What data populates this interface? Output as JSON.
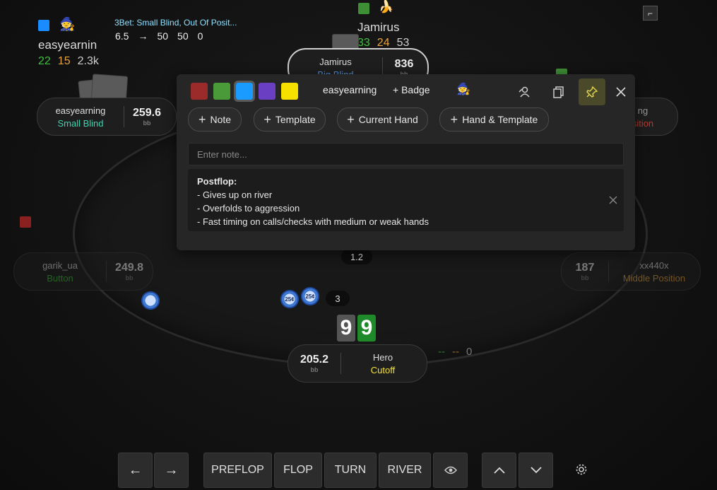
{
  "top_left_player": {
    "name": "easyearnin",
    "stats": [
      "22",
      "15",
      "2.3k"
    ],
    "stat_colors": [
      "#3ec23e",
      "#e8a33c",
      "#cfcfcf"
    ],
    "action_line": "3Bet: Small Blind, Out Of Posit...",
    "action_values": [
      "6.5",
      "→",
      "50",
      "50",
      "0"
    ]
  },
  "top_center_player": {
    "name": "Jamirus",
    "stats": [
      "33",
      "24",
      "53"
    ],
    "stat_colors": [
      "#3ec23e",
      "#e8a33c",
      "#cfcfcf"
    ],
    "emoji": "🍌"
  },
  "seats": {
    "small_blind": {
      "name": "easyearning",
      "position": "Small Blind",
      "stack": "259.6",
      "unit": "bb",
      "position_color": "#3fd3b0"
    },
    "big_blind": {
      "name": "Jamirus",
      "position": "Big Blind",
      "stack": "836",
      "unit": "bb",
      "position_color": "#4f8fe0"
    },
    "right_top": {
      "name": "ng",
      "position": "sition",
      "position_color": "#c0392b"
    },
    "button": {
      "name": "garik_ua",
      "position": "Button",
      "stack": "249.8",
      "unit": "bb",
      "position_color": "#3ec23e"
    },
    "middle": {
      "name": "xx440x",
      "position": "Middle Position",
      "stack": "187",
      "unit": "bb",
      "position_color": "#e8a33c"
    },
    "hero": {
      "name": "Hero",
      "position": "Cutoff",
      "stack": "205.2",
      "unit": "bb",
      "position_color": "#f2e23a"
    }
  },
  "pot": {
    "main": "1.2",
    "side": "3",
    "chip1": "25¢",
    "chip2": "25¢"
  },
  "hero_cards": [
    "9",
    "9"
  ],
  "hero_stats": [
    "--",
    "--",
    "0"
  ],
  "popup": {
    "colors": [
      "#9b2a2a",
      "#4a9a3a",
      "#1a9bff",
      "#6b3fc2",
      "#f5e000"
    ],
    "player_name": "easyearning",
    "badge_label": "+ Badge",
    "buttons": [
      "Note",
      "Template",
      "Current Hand",
      "Hand & Template"
    ],
    "note_placeholder": "Enter note...",
    "note_lines": [
      "Postflop:",
      "- Gives up on river",
      "- Overfolds to aggression",
      "- Fast timing on calls/checks with medium or weak hands"
    ]
  },
  "nav": {
    "back": "←",
    "forward": "→",
    "streets": [
      "PREFLOP",
      "FLOP",
      "TURN",
      "RIVER"
    ],
    "up": "⌃",
    "down": "⌄"
  }
}
